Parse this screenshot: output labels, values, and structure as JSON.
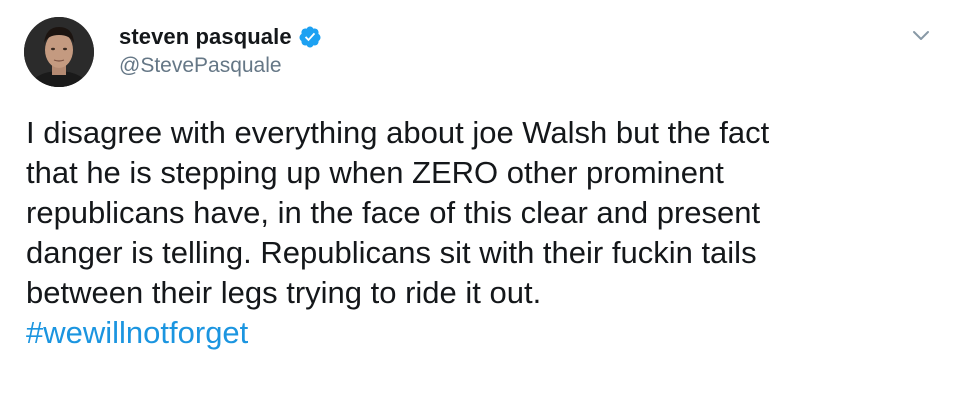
{
  "author": {
    "display_name": "steven pasquale",
    "handle": "@StevePasquale",
    "verified": true
  },
  "tweet": {
    "lines": [
      "I disagree with everything about joe Walsh but the fact",
      "that he is stepping up when ZERO other prominent",
      "republicans have, in the face of this clear and present",
      "danger is telling. Republicans sit with their fuckin tails",
      "between their legs trying to ride it out."
    ],
    "hashtag": "#wewillnotforget"
  },
  "colors": {
    "verified_badge": "#1da1f2",
    "hashtag": "#1b95e0",
    "handle": "#657786",
    "text": "#14171a"
  },
  "icons": {
    "verified": "verified-badge-icon",
    "menu": "chevron-down-icon"
  }
}
